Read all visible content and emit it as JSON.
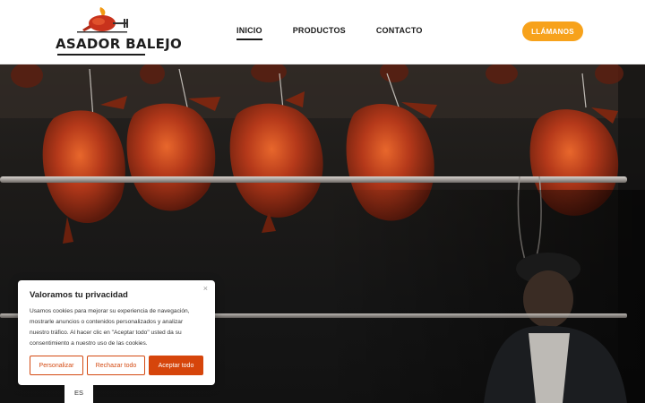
{
  "logo": {
    "text": "ASADOR BALEJO",
    "icon": "roast-chicken-grill-logo"
  },
  "nav": {
    "items": [
      "INICIO",
      "PRODUCTOS",
      "CONTACTO"
    ],
    "active": "INICIO"
  },
  "header": {
    "call_label": "LLÁMANOS"
  },
  "hero": {
    "image": "roast-ducks-hanging-on-rail"
  },
  "cookie": {
    "title": "Valoramos tu privacidad",
    "close": "×",
    "text": "Usamos cookies para mejorar su experiencia de navegación, mostrarle anuncios o contenidos personalizados y analizar nuestro tráfico. Al hacer clic en \"Aceptar todo\" usted da su consentimiento a nuestro uso de las cookies.",
    "customize": "Personalizar",
    "reject": "Rechazar todo",
    "accept": "Aceptar todo"
  },
  "language": {
    "current": "ES"
  },
  "colors": {
    "accent": "#f7a21b",
    "cookie_accent": "#d6450b"
  }
}
